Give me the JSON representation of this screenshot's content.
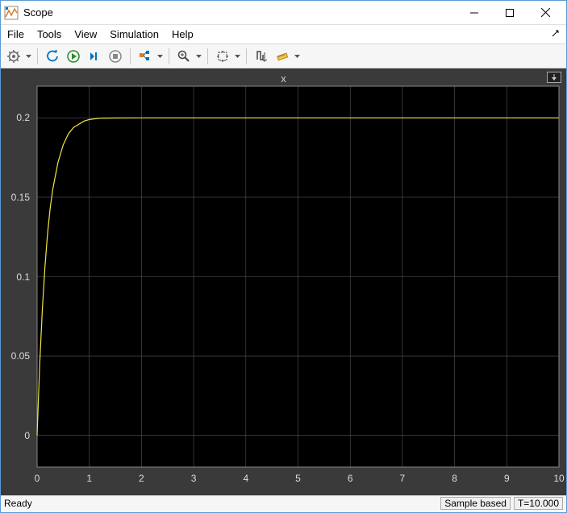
{
  "window": {
    "title": "Scope"
  },
  "menu": {
    "file": "File",
    "tools": "Tools",
    "view": "View",
    "simulation": "Simulation",
    "help": "Help"
  },
  "plot": {
    "title": "x"
  },
  "status": {
    "ready": "Ready",
    "mode": "Sample based",
    "time": "T=10.000"
  },
  "chart_data": {
    "type": "line",
    "title": "x",
    "xlabel": "",
    "ylabel": "",
    "xlim": [
      0,
      10
    ],
    "ylim": [
      -0.02,
      0.22
    ],
    "xticks": [
      0,
      1,
      2,
      3,
      4,
      5,
      6,
      7,
      8,
      9,
      10
    ],
    "yticks": [
      0,
      0.05,
      0.1,
      0.15,
      0.2
    ],
    "series": [
      {
        "name": "x",
        "color": "#f5e642",
        "x": [
          0,
          0.05,
          0.1,
          0.15,
          0.2,
          0.25,
          0.3,
          0.4,
          0.5,
          0.6,
          0.7,
          0.8,
          0.9,
          1.0,
          1.2,
          1.5,
          2,
          3,
          4,
          5,
          6,
          7,
          8,
          9,
          10
        ],
        "y": [
          0,
          0.045,
          0.079,
          0.106,
          0.127,
          0.143,
          0.155,
          0.172,
          0.183,
          0.19,
          0.194,
          0.196,
          0.198,
          0.199,
          0.1998,
          0.19997,
          0.2,
          0.2,
          0.2,
          0.2,
          0.2,
          0.2,
          0.2,
          0.2,
          0.2
        ]
      }
    ]
  }
}
